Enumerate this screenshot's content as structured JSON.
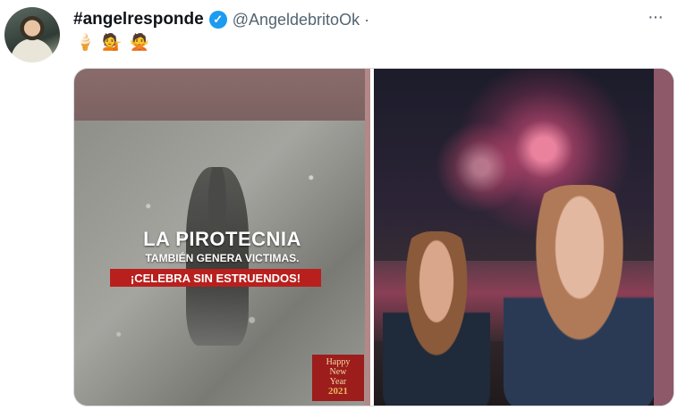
{
  "tweet": {
    "display_name": "#angelresponde",
    "handle": "@AngeldebritoOk ·",
    "more": "···",
    "emojis": [
      "🍦",
      "💁",
      "🙅"
    ]
  },
  "media": {
    "left_image": {
      "headline": "LA PIROTECNIA",
      "subheadline": "TAMBIÉN GENERA VICTIMAS.",
      "banner": "¡CELEBRA SIN ESTRUENDOS!",
      "corner_text_1": "Happy",
      "corner_text_2": "New",
      "corner_text_3": "Year",
      "corner_year": "2021"
    }
  },
  "colors": {
    "verified": "#1d9bf0",
    "banner_red": "#b8201e",
    "text_primary": "#0f1419",
    "text_secondary": "#536471"
  }
}
